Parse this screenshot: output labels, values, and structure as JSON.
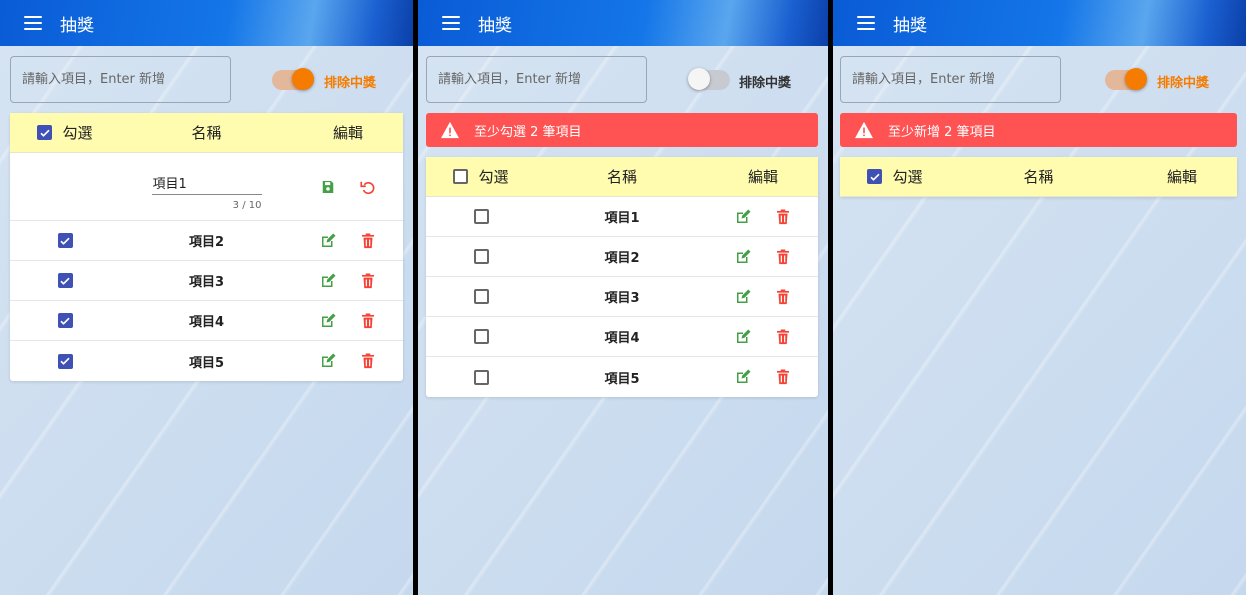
{
  "app": {
    "title": "抽獎"
  },
  "input": {
    "placeholder": "請輸入項目，Enter 新增"
  },
  "switch_label": "排除中獎",
  "headers": {
    "check": "勾選",
    "name": "名稱",
    "edit": "編輯"
  },
  "colors": {
    "accent": "#f57c00",
    "alert": "#ff5252",
    "header_bg": "#fffcb0",
    "checkbox": "#3f51b5",
    "edit_icon": "#43a047",
    "delete_icon": "#f44336"
  },
  "panel1": {
    "switch_on": true,
    "editing": {
      "value": "項目1",
      "counter": "3 / 10"
    },
    "rows": [
      {
        "name": "項目2",
        "checked": true
      },
      {
        "name": "項目3",
        "checked": true
      },
      {
        "name": "項目4",
        "checked": true
      },
      {
        "name": "項目5",
        "checked": true
      }
    ]
  },
  "panel2": {
    "switch_on": false,
    "alert": "至少勾選 2 筆項目",
    "rows": [
      {
        "name": "項目1",
        "checked": false
      },
      {
        "name": "項目2",
        "checked": false
      },
      {
        "name": "項目3",
        "checked": false
      },
      {
        "name": "項目4",
        "checked": false
      },
      {
        "name": "項目5",
        "checked": false
      }
    ]
  },
  "panel3": {
    "switch_on": true,
    "alert": "至少新增 2 筆項目",
    "rows": []
  },
  "icons": [
    "menu-icon",
    "warning-icon",
    "save-icon",
    "undo-icon",
    "edit-icon",
    "delete-icon",
    "check-icon"
  ]
}
